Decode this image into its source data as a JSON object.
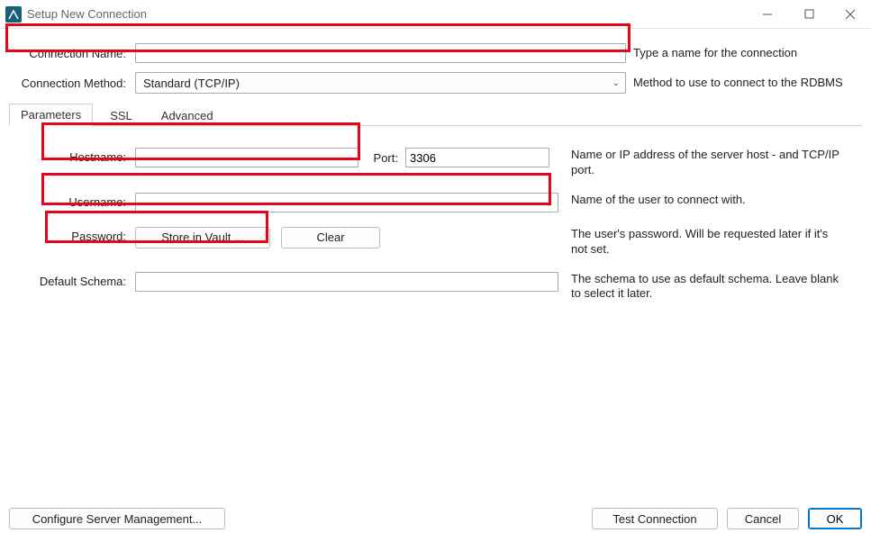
{
  "window": {
    "title": "Setup New Connection"
  },
  "header": {
    "connection_name_label": "Connection Name:",
    "connection_name_value": "",
    "connection_name_desc": "Type a name for the connection",
    "connection_method_label": "Connection Method:",
    "connection_method_value": "Standard (TCP/IP)",
    "connection_method_desc": "Method to use to connect to the RDBMS"
  },
  "tabs": {
    "parameters": "Parameters",
    "ssl": "SSL",
    "advanced": "Advanced"
  },
  "form": {
    "hostname_label": "Hostname:",
    "hostname_value": "",
    "port_label": "Port:",
    "port_value": "3306",
    "host_help": "Name or IP address of the server host - and TCP/IP port.",
    "username_label": "Username:",
    "username_value": "",
    "username_help": "Name of the user to connect with.",
    "password_label": "Password:",
    "store_btn": "Store in Vault ...",
    "clear_btn": "Clear",
    "password_help": "The user's password. Will be requested later if it's not set.",
    "schema_label": "Default Schema:",
    "schema_value": "",
    "schema_help": "The schema to use as default schema. Leave blank to select it later."
  },
  "footer": {
    "configure": "Configure Server Management...",
    "test": "Test Connection",
    "cancel": "Cancel",
    "ok": "OK"
  }
}
